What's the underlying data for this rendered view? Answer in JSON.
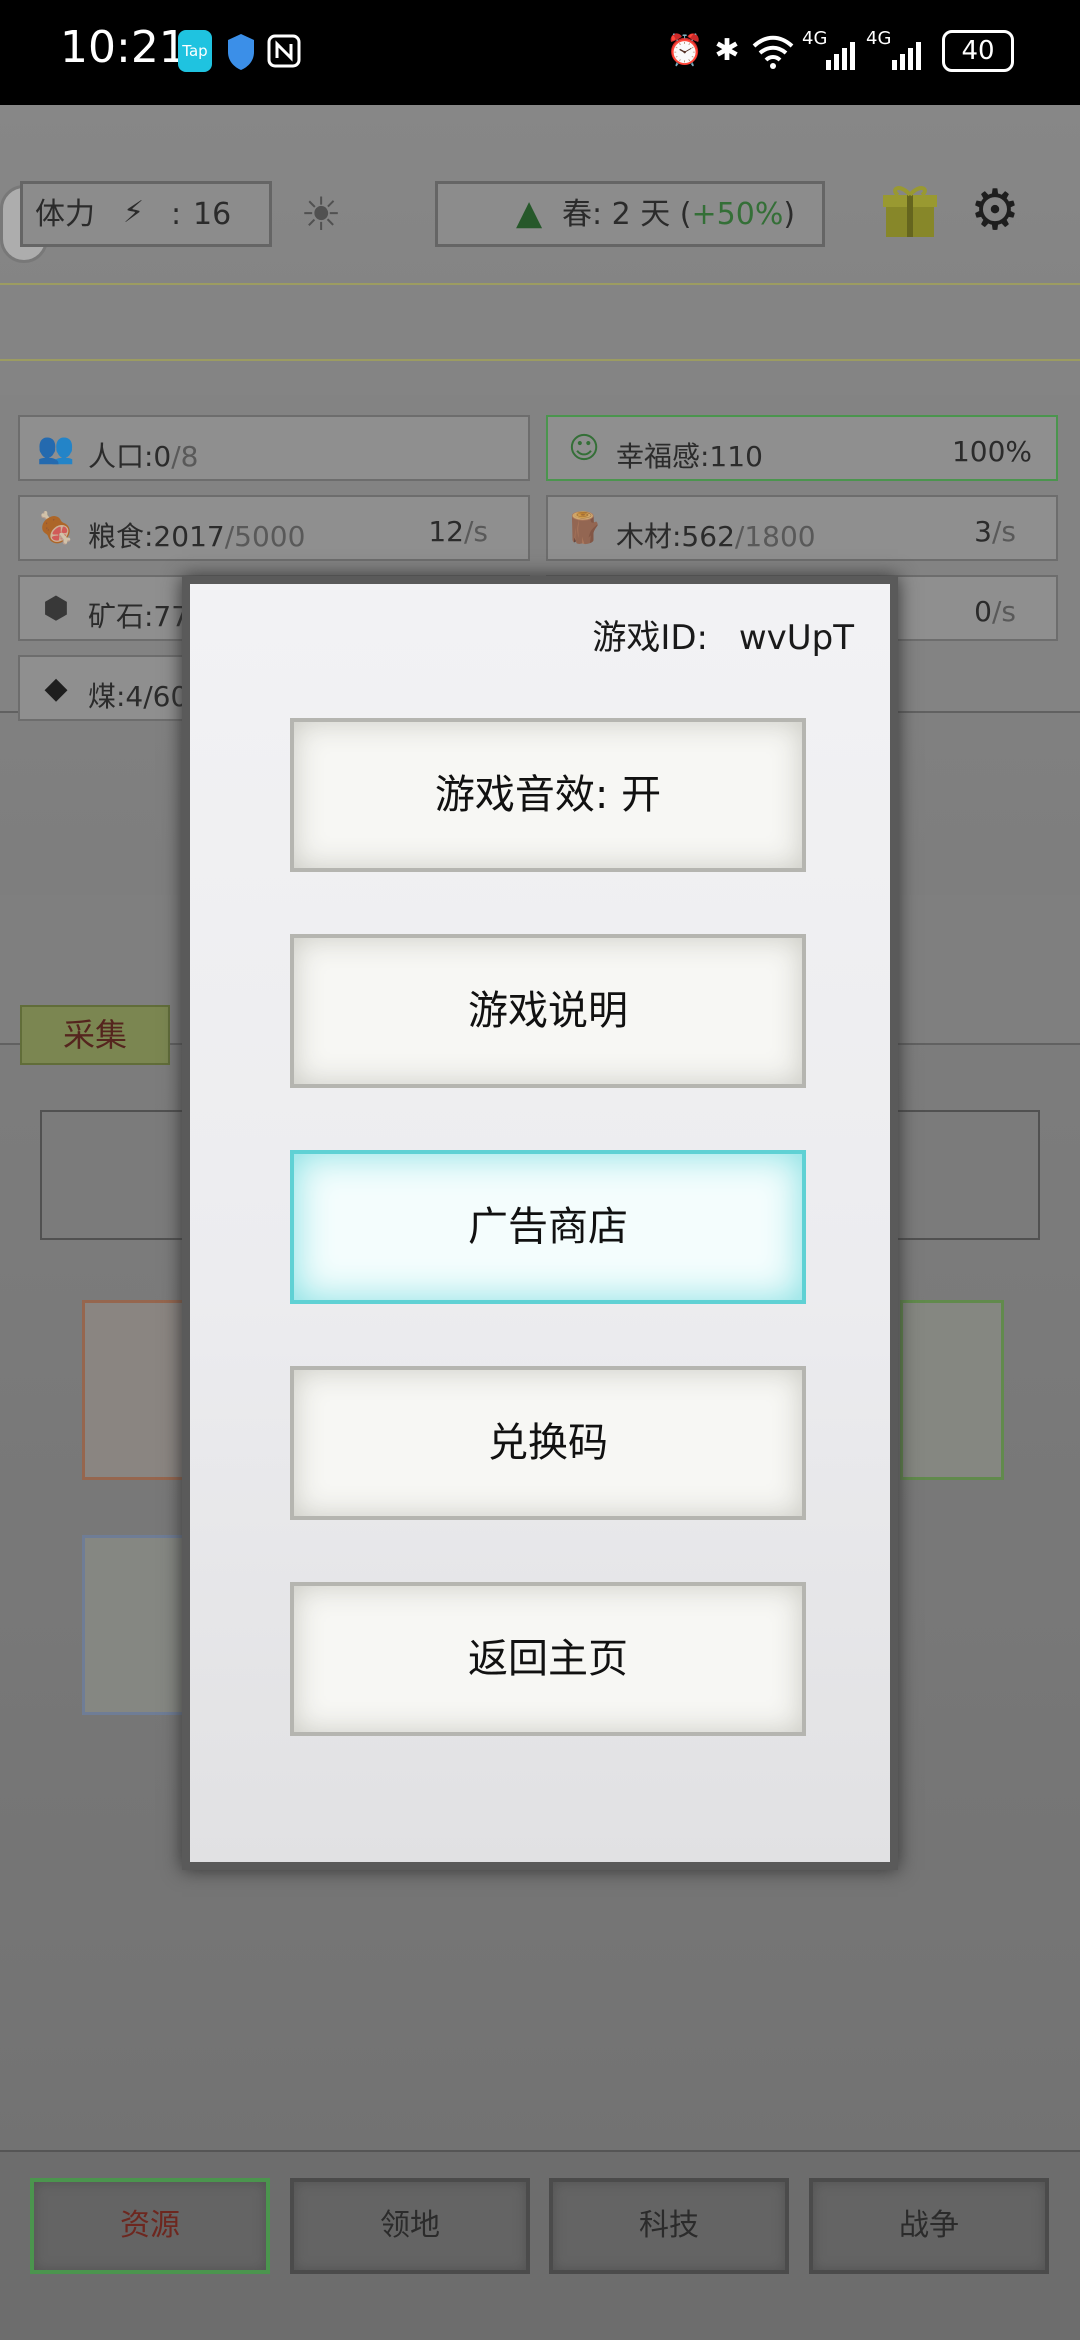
{
  "status_bar": {
    "time": "10:21",
    "app_badges": [
      "Tap",
      "shield-icon",
      "nfc-icon"
    ],
    "right_icons": [
      "alarm-icon",
      "bluetooth-icon",
      "wifi-icon",
      "4G",
      "4G"
    ],
    "battery": "40"
  },
  "top": {
    "stamina_label": "体力",
    "stamina_value": "16",
    "season_label": "春: 2 天 (",
    "season_bonus": "+50%",
    "season_suffix": ")"
  },
  "resources": {
    "population": {
      "label": "人口:0",
      "max": "/8"
    },
    "happiness": {
      "label": "幸福感:110",
      "percent": "100%"
    },
    "food": {
      "label": "粮食:2017",
      "max": "/5000",
      "rate": "12",
      "unit": "/s"
    },
    "wood": {
      "label": "木材:562",
      "max": "/1800",
      "rate": "3",
      "unit": "/s"
    },
    "ore": {
      "label": "矿石:77",
      "rate": "0",
      "unit": "/s"
    },
    "coal": {
      "label": "煤:4/60"
    }
  },
  "tabs": {
    "gather": "采集"
  },
  "dialog": {
    "game_id_label": "游戏ID:",
    "game_id_value": "wvUpT",
    "buttons": [
      "游戏音效: 开",
      "游戏说明",
      "广告商店",
      "兑换码",
      "返回主页"
    ]
  },
  "bottom_nav": [
    "资源",
    "领地",
    "科技",
    "战争"
  ],
  "colors": {
    "accent_green": "#2e7d32",
    "active_button": "#5fd1d4",
    "gift_yellow": "#c8c83a"
  }
}
